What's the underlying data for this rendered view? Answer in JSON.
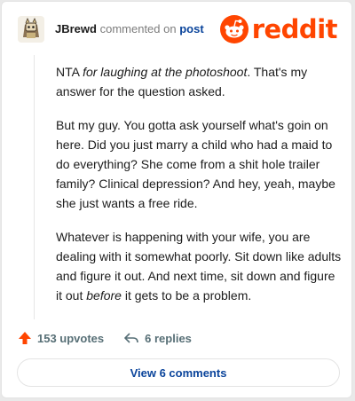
{
  "header": {
    "username": "JBrewd",
    "action_text": "commented on",
    "post_link": "post",
    "logo_text": "reddit",
    "brand_color": "#ff4500"
  },
  "comment": {
    "p1_a": "NTA ",
    "p1_em": "for laughing at the photoshoot",
    "p1_b": ". That's my answer for the question asked.",
    "p2": "But my guy. You gotta ask yourself what's goin on here. Did you just marry a child who had a maid to do everything? She come from a shit hole trailer family? Clinical depression? And hey, yeah, maybe she just wants a free ride.",
    "p3_a": "Whatever is happening with your wife, you are dealing with it somewhat poorly. Sit down like adults and figure it out. And next time, sit down and figure it out ",
    "p3_em": "before",
    "p3_b": " it gets to be a problem."
  },
  "footer": {
    "upvotes": "153 upvotes",
    "replies": "6 replies",
    "upvote_icon": "upvote-arrow-icon",
    "reply_icon": "reply-arrow-icon"
  },
  "view_comments_label": "View 6 comments"
}
